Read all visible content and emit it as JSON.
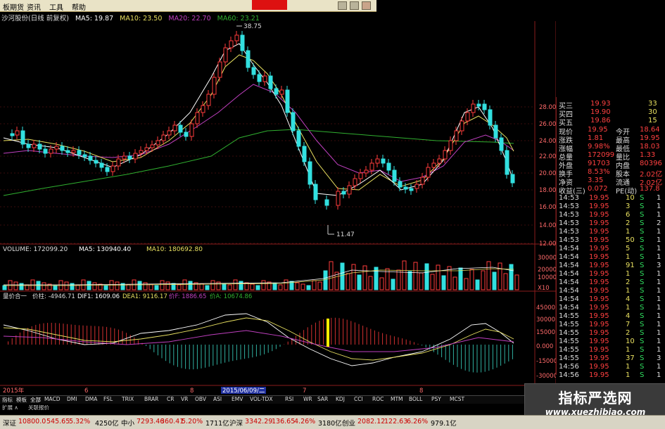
{
  "menu": {
    "items": [
      "板期货",
      "资讯",
      "工具",
      "帮助"
    ],
    "alert": "",
    "window_buttons": [
      "minimize",
      "maximize",
      "close"
    ]
  },
  "indicator_line": {
    "stock": "沙河股份(日线 前复权)",
    "ma5": "MA5: 19.87",
    "ma10": "MA10: 23.50",
    "ma20": "MA20: 22.70",
    "ma60": "MA60: 23.21"
  },
  "price_axis": [
    "28.00",
    "26.00",
    "24.00",
    "22.00",
    "20.00",
    "18.00",
    "16.00",
    "14.00",
    "12.00"
  ],
  "price_marks": {
    "high": "38.75",
    "low": "11.47"
  },
  "volume_line": {
    "volume": "VOLUME: 172099.20",
    "ma5": "MA5: 130940.40",
    "ma10": "MA10: 180692.80"
  },
  "volume_axis": [
    "30000",
    "20000",
    "10000",
    "X10"
  ],
  "macd_line": {
    "name": "量价合一",
    "price": "价柱: -4946.71",
    "dif": "DIF1: 1609.06",
    "dea": "DEA1: 9116.17",
    "pricef": "价F: 1886.65",
    "vol": "价A: 10674.86"
  },
  "macd_axis": [
    "45000",
    "30000",
    "15000",
    "0.000",
    "-15000",
    "-30000"
  ],
  "time_axis": {
    "year": "2015年",
    "m1": "6",
    "m2": "8",
    "selected_date": "2015/06/09/二",
    "m3": "7",
    "m4": "8"
  },
  "quote": {
    "asks": [
      {
        "label": "买三",
        "price": "19.93",
        "vol": "33"
      },
      {
        "label": "买四",
        "price": "19.90",
        "vol": "30"
      },
      {
        "label": "买五",
        "price": "19.86",
        "vol": "15"
      }
    ],
    "stats": [
      {
        "l1": "现价",
        "v1": "19.95",
        "l2": "今开",
        "v2": "18.64"
      },
      {
        "l1": "涨跌",
        "v1": "1.81",
        "l2": "最高",
        "v2": "19.95"
      },
      {
        "l1": "涨幅",
        "v1": "9.98%",
        "l2": "最低",
        "v2": "18.03"
      },
      {
        "l1": "总量",
        "v1": "172099",
        "l2": "量比",
        "v2": "1.33"
      },
      {
        "l1": "外盘",
        "v1": "91703",
        "l2": "内盘",
        "v2": "80396"
      },
      {
        "l1": "换手",
        "v1": "8.53%",
        "l2": "股本",
        "v2": "2.02亿"
      },
      {
        "l1": "净资",
        "v1": "3.35",
        "l2": "流通",
        "v2": "2.02亿"
      },
      {
        "l1": "收益(三)",
        "v1": "0.072",
        "l2": "PE(动)",
        "v2": "137.8"
      }
    ],
    "ticks": [
      {
        "t": "14:53",
        "p": "19.95",
        "v": "10",
        "s": "S",
        "n": "1"
      },
      {
        "t": "14:53",
        "p": "19.95",
        "v": "3",
        "s": "S",
        "n": "1"
      },
      {
        "t": "14:53",
        "p": "19.95",
        "v": "6",
        "s": "S",
        "n": "1"
      },
      {
        "t": "14:53",
        "p": "19.95",
        "v": "2",
        "s": "S",
        "n": "2"
      },
      {
        "t": "14:53",
        "p": "19.95",
        "v": "1",
        "s": "S",
        "n": "1"
      },
      {
        "t": "14:53",
        "p": "19.95",
        "v": "50",
        "s": "S",
        "n": "1"
      },
      {
        "t": "14:54",
        "p": "19.95",
        "v": "5",
        "s": "S",
        "n": "1"
      },
      {
        "t": "14:54",
        "p": "19.95",
        "v": "1",
        "s": "S",
        "n": "1"
      },
      {
        "t": "14:54",
        "p": "19.95",
        "v": "91",
        "s": "S",
        "n": "3"
      },
      {
        "t": "14:54",
        "p": "19.95",
        "v": "1",
        "s": "S",
        "n": "1"
      },
      {
        "t": "14:54",
        "p": "19.95",
        "v": "2",
        "s": "S",
        "n": "1"
      },
      {
        "t": "14:54",
        "p": "19.95",
        "v": "1",
        "s": "S",
        "n": "1"
      },
      {
        "t": "14:54",
        "p": "19.95",
        "v": "4",
        "s": "S",
        "n": "1"
      },
      {
        "t": "14:54",
        "p": "19.95",
        "v": "1",
        "s": "S",
        "n": "1"
      },
      {
        "t": "14:55",
        "p": "19.95",
        "v": "4",
        "s": "S",
        "n": "1"
      },
      {
        "t": "14:55",
        "p": "19.95",
        "v": "7",
        "s": "S",
        "n": "1"
      },
      {
        "t": "14:55",
        "p": "19.95",
        "v": "2",
        "s": "S",
        "n": "1"
      },
      {
        "t": "14:55",
        "p": "19.95",
        "v": "10",
        "s": "S",
        "n": "1"
      },
      {
        "t": "14:55",
        "p": "19.95",
        "v": "1",
        "s": "S",
        "n": "1"
      },
      {
        "t": "14:55",
        "p": "19.95",
        "v": "37",
        "s": "S",
        "n": "3"
      },
      {
        "t": "14:56",
        "p": "19.95",
        "v": "1",
        "s": "S",
        "n": "1"
      },
      {
        "t": "14:56",
        "p": "19.95",
        "v": "1",
        "s": "S",
        "n": "1"
      }
    ]
  },
  "tabs": [
    "指标",
    "模板",
    "全部",
    "MACD",
    "DMI",
    "DMA",
    "FSL",
    "TRIX",
    "BRAR",
    "CR",
    "VR",
    "OBV",
    "ASI",
    "EMV",
    "VOL-TDX",
    "RSI",
    "WR",
    "SAR",
    "KDJ",
    "CCI",
    "ROC",
    "MTM",
    "BOLL",
    "PSY",
    "MCST"
  ],
  "tabs2": [
    "扩展 ∧",
    "关联报价"
  ],
  "status": {
    "sz_label": "深证",
    "sz_val": "10800.0",
    "sz_chg": "545.65",
    "sz_pct": "5.32%",
    "sz_amt": "4250亿",
    "zx_label": "中小",
    "zx_val": "7293.46",
    "zx_chg": "360.41",
    "zx_pct": "5.20%",
    "zx_amt": "1711亿",
    "sh_label": "沪深",
    "sh_val": "3342.29",
    "sh_chg": "136.65",
    "sh_pct": "4.26%",
    "sh_amt": "3180亿",
    "cy_label": "创业",
    "cy_val": "2082.12",
    "cy_chg": "122.63",
    "cy_pct": "6.26%",
    "cy_amt": "979.1亿"
  },
  "watermark": {
    "title": "指标严选网",
    "url": "www.xuezhibiao.com"
  },
  "colors": {
    "up": "#ff3b3b",
    "down": "#32e0e0",
    "ma5": "#ffffff",
    "ma10": "#e8e060",
    "ma20": "#c040c0",
    "ma60": "#30b030",
    "accent": "#ffee00"
  }
}
